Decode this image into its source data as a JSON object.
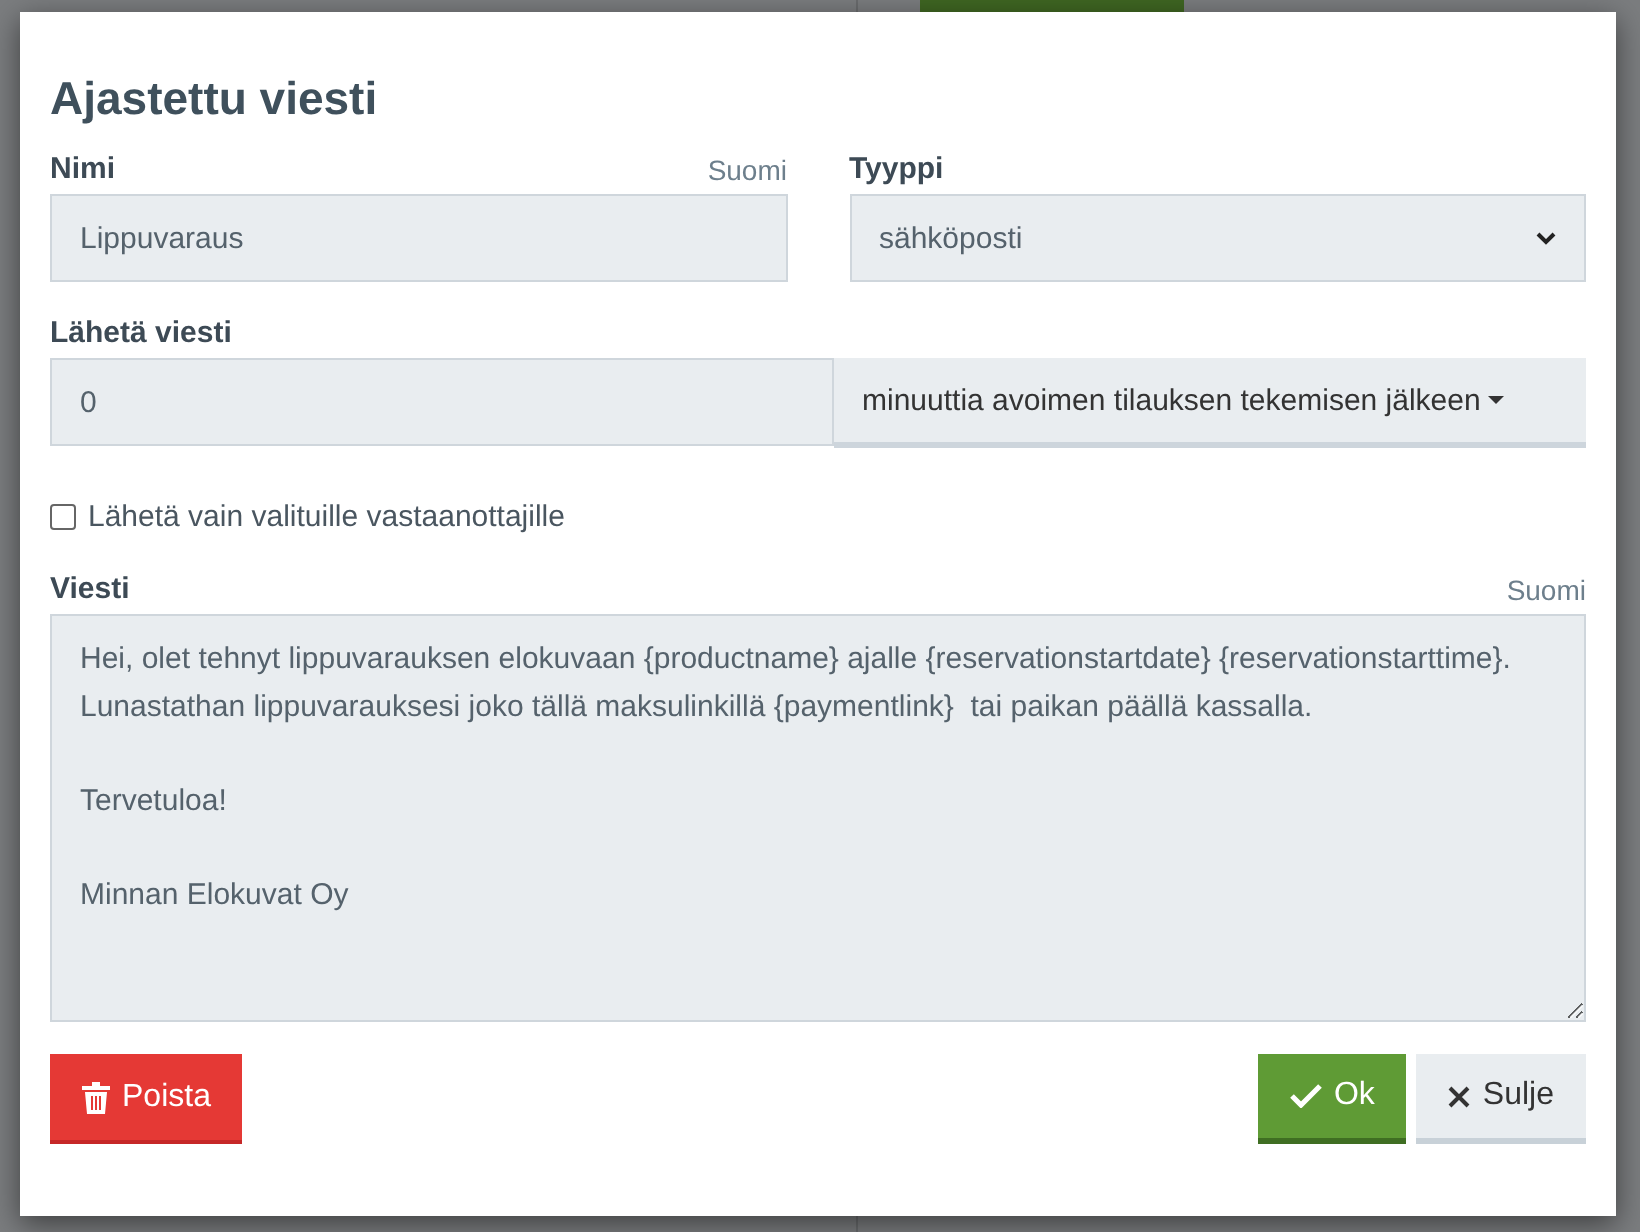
{
  "dialog": {
    "title": "Ajastettu viesti",
    "name_field": {
      "label": "Nimi",
      "language": "Suomi",
      "value": "Lippuvaraus"
    },
    "type_field": {
      "label": "Tyyppi",
      "value": "sähköposti"
    },
    "send_field": {
      "label": "Lähetä viesti",
      "value": "0",
      "unit": "minuuttia avoimen tilauksen tekemisen jälkeen"
    },
    "selected_only": {
      "label": "Lähetä vain valituille vastaanottajille",
      "checked": false
    },
    "message_field": {
      "label": "Viesti",
      "language": "Suomi",
      "value": "Hei, olet tehnyt lippuvarauksen elokuvaan {productname} ajalle {reservationstartdate} {reservationstarttime}. Lunastathan lippuvarauksesi joko tällä maksulinkillä {paymentlink}  tai paikan päällä kassalla.\n\nTervetuloa!\n\nMinnan Elokuvat Oy"
    },
    "buttons": [
      {
        "kind": "delete",
        "label": "Poista"
      },
      {
        "kind": "ok",
        "label": "Ok"
      },
      {
        "kind": "close",
        "label": "Sulje"
      }
    ]
  }
}
